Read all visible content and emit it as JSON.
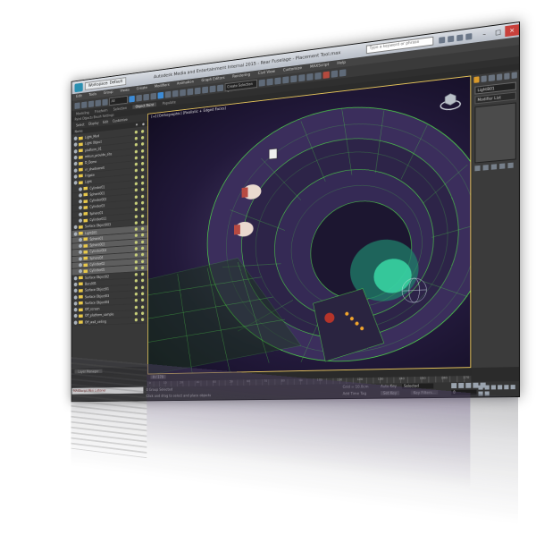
{
  "window": {
    "title": "Autodesk Media and Entertainment Internal 2015 - Rear Fuselage - Placement Tool.max",
    "workspace_label": "Workspace: Default",
    "search_placeholder": "Type a keyword or phrase",
    "controls": {
      "minimize": "–",
      "maximize": "□",
      "close": "×"
    }
  },
  "menubar": [
    "Edit",
    "Tools",
    "Group",
    "Views",
    "Create",
    "Modifiers",
    "Animation",
    "Graph Editors",
    "Rendering",
    "Civil View",
    "Customize",
    "MAXScript",
    "Help"
  ],
  "toolbar": {
    "selection_dropdown": "All",
    "named_set_dropdown": "Create Selection Set"
  },
  "ribbon": {
    "tabs": [
      "Modeling",
      "Freeform",
      "Selection",
      "Object Paint",
      "Populate"
    ],
    "active_tab": "Object Paint"
  },
  "subribbon": {
    "text": "Paint Objects   Brush Settings"
  },
  "explorer": {
    "tabs": [
      "Select",
      "Display",
      "Edit",
      "Customize"
    ],
    "column_name": "Name",
    "rows": [
      {
        "label": "Light_Mod",
        "indent": 0,
        "hl": false
      },
      {
        "label": "Light Object",
        "indent": 0,
        "hl": false
      },
      {
        "label": "platform_01",
        "indent": 0,
        "hl": false
      },
      {
        "label": "mtsun_provide_site",
        "indent": 0,
        "hl": false
      },
      {
        "label": "D_Dome",
        "indent": 0,
        "hl": false
      },
      {
        "label": "vr_shadowrelt",
        "indent": 0,
        "hl": false
      },
      {
        "label": "Frigate",
        "indent": 0,
        "hl": false
      },
      {
        "label": "Light",
        "indent": 0,
        "hl": false
      },
      {
        "label": "Cylinder01",
        "indent": 1,
        "hl": false
      },
      {
        "label": "Sphere001",
        "indent": 1,
        "hl": false
      },
      {
        "label": "Cylinder002",
        "indent": 1,
        "hl": false
      },
      {
        "label": "Cylinder03",
        "indent": 1,
        "hl": false
      },
      {
        "label": "Sphere01",
        "indent": 1,
        "hl": false
      },
      {
        "label": "Cylinder011",
        "indent": 1,
        "hl": false
      },
      {
        "label": "Surface Object003",
        "indent": 0,
        "hl": false
      },
      {
        "label": "LightB01",
        "indent": 0,
        "hl": true
      },
      {
        "label": "Sphere01",
        "indent": 1,
        "hl": true
      },
      {
        "label": "Sphere003",
        "indent": 1,
        "hl": true
      },
      {
        "label": "Cylinder004",
        "indent": 1,
        "hl": true
      },
      {
        "label": "Sphere04",
        "indent": 1,
        "hl": true
      },
      {
        "label": "Cylinder02",
        "indent": 1,
        "hl": true
      },
      {
        "label": "Cylinder05",
        "indent": 1,
        "hl": true
      },
      {
        "label": "Surface Object02",
        "indent": 0,
        "hl": false
      },
      {
        "label": "Bars001",
        "indent": 0,
        "hl": false
      },
      {
        "label": "Surface Object01",
        "indent": 0,
        "hl": false
      },
      {
        "label": "Surface Object03",
        "indent": 0,
        "hl": false
      },
      {
        "label": "Surface Object04",
        "indent": 0,
        "hl": false
      },
      {
        "label": "Off_screen",
        "indent": 0,
        "hl": false
      },
      {
        "label": "Off_platform_sample",
        "indent": 0,
        "hl": false
      },
      {
        "label": "Off_wall_ceiling",
        "indent": 0,
        "hl": false
      }
    ],
    "footer": "Layer Manager"
  },
  "viewport": {
    "label": "[+] [Orthographic] [Realistic + Edged Faces]",
    "background": "#2a2140",
    "wire_color": "#4fd84a"
  },
  "command_panel": {
    "object_name": "LightB01",
    "modifier_list": "Modifier List"
  },
  "timeline": {
    "frame_label": "0 / 170",
    "ticks": [
      "0",
      "10",
      "20",
      "30",
      "40",
      "50",
      "60",
      "70",
      "80",
      "90",
      "100",
      "110",
      "120",
      "130",
      "140",
      "150",
      "160",
      "170"
    ]
  },
  "status": {
    "maxscript": "MAXScript Mini Listener",
    "selection_info": "0 Group Selected",
    "prompt": "Click and drag to select and place objects",
    "grid": "Grid = 10.0cm",
    "add_time_tag": "Add Time Tag",
    "auto_key": "Auto Key",
    "selected": "Selected",
    "set_key": "Set Key",
    "key_filters": "Key Filters...",
    "current_frame": "0"
  },
  "colors": {
    "accent": "#e3c25a",
    "ui_dark": "#2b2b2b",
    "selection_blue": "#3c8bd6"
  }
}
